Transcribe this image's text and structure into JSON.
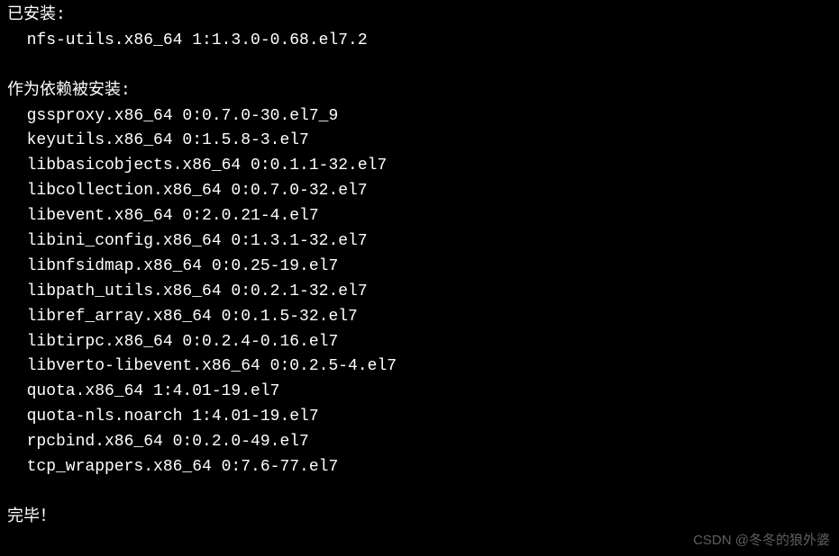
{
  "sections": {
    "installed_header": "已安装:",
    "installed_packages": [
      "nfs-utils.x86_64 1:1.3.0-0.68.el7.2"
    ],
    "deps_header": "作为依赖被安装:",
    "deps_packages": [
      "gssproxy.x86_64 0:0.7.0-30.el7_9",
      "keyutils.x86_64 0:1.5.8-3.el7",
      "libbasicobjects.x86_64 0:0.1.1-32.el7",
      "libcollection.x86_64 0:0.7.0-32.el7",
      "libevent.x86_64 0:2.0.21-4.el7",
      "libini_config.x86_64 0:1.3.1-32.el7",
      "libnfsidmap.x86_64 0:0.25-19.el7",
      "libpath_utils.x86_64 0:0.2.1-32.el7",
      "libref_array.x86_64 0:0.1.5-32.el7",
      "libtirpc.x86_64 0:0.2.4-0.16.el7",
      "libverto-libevent.x86_64 0:0.2.5-4.el7",
      "quota.x86_64 1:4.01-19.el7",
      "quota-nls.noarch 1:4.01-19.el7",
      "rpcbind.x86_64 0:0.2.0-49.el7",
      "tcp_wrappers.x86_64 0:7.6-77.el7"
    ],
    "complete": "完毕！"
  },
  "watermark": "CSDN @冬冬的狼外婆"
}
